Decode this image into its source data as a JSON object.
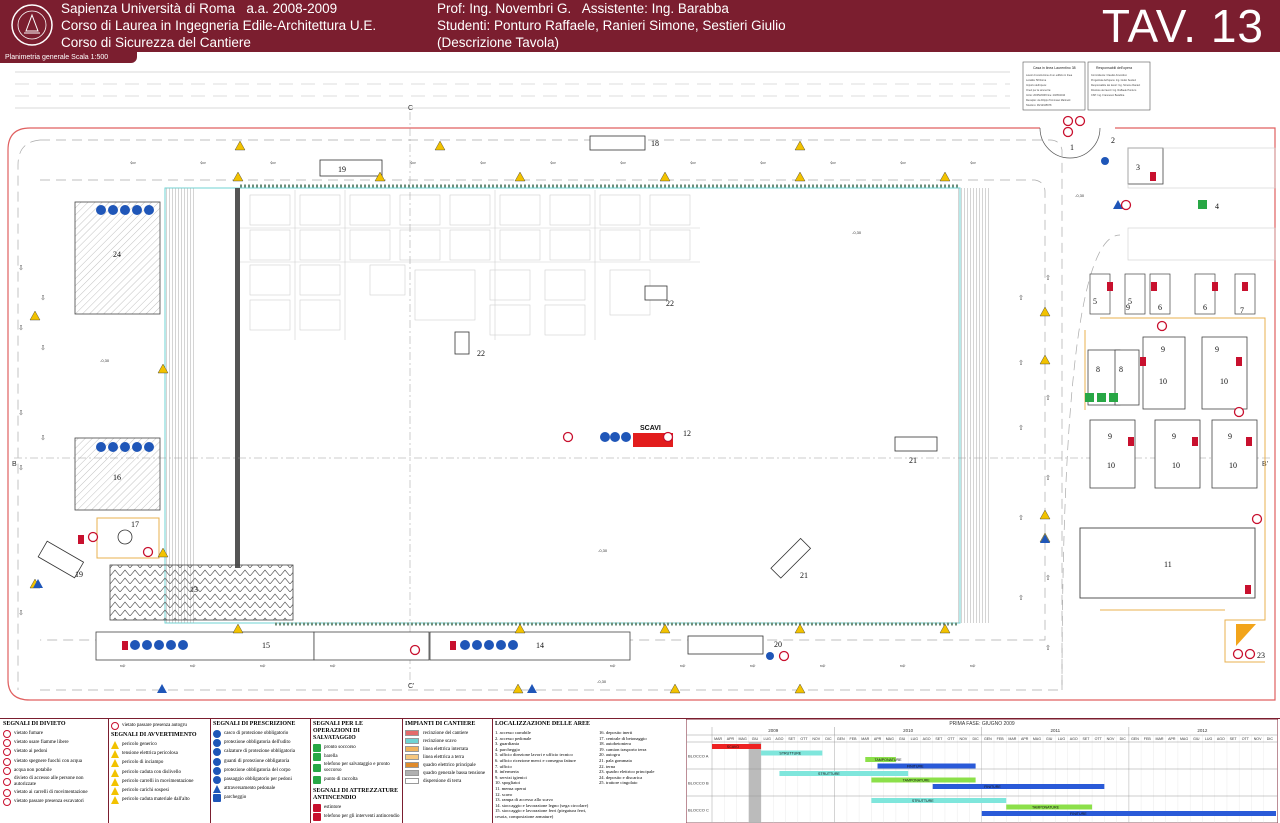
{
  "header": {
    "university": "Sapienza Università di Roma",
    "year": "a.a. 2008-2009",
    "course1": "Corso di Laurea in Ingegneria Edile-Architettura U.E.",
    "course2": "Corso di Sicurezza del Cantiere",
    "professors": "Prof: Ing. Novembri G.   Assistente: Ing. Barabba",
    "students": "Studenti: Ponturo Raffaele, Ranieri Simone, Sestieri Giulio",
    "description": "(Descrizione Tavola)",
    "tav": "TAV. 13"
  },
  "plan": {
    "subtitle": "Planimetria generale Scala 1:500",
    "section_labels": [
      "C",
      "C'",
      "B",
      "B'"
    ],
    "area_labels": {
      "a1": "1",
      "a2": "2",
      "a3": "3",
      "a4": "4",
      "a5a": "5",
      "a5b": "5",
      "a6a": "6",
      "a6b": "6",
      "a7": "7",
      "a8a": "8",
      "a8b": "8",
      "a9a": "9",
      "a9b": "9",
      "a9c": "9",
      "a9d": "9",
      "a9e": "9",
      "a9f": "9",
      "a10a": "10",
      "a10b": "10",
      "a10c": "10",
      "a10d": "10",
      "a10e": "10",
      "a11": "11",
      "a12": "12",
      "a13": "13",
      "a14": "14",
      "a15": "15",
      "a16": "16",
      "a17": "17",
      "a18": "18",
      "a19a": "19",
      "a19b": "19",
      "a20": "20",
      "a21a": "21",
      "a21b": "21",
      "a22a": "22",
      "a22b": "22",
      "a23": "23",
      "a24": "24"
    },
    "scavi_label": "SCAVI",
    "elevations": [
      "-0,30",
      "-0,30",
      "-0,30",
      "-0,30",
      "-0,30"
    ],
    "cartello": {
      "title": "Casa in linea Laurentino 38",
      "lines": [
        "Lavori di costruzione di un edificio in linea",
        "Località: 58 Roma",
        "Importo dell'opera:",
        "Oneri per la sicurezza:",
        "Inizio: 20/05/2008    Fine: 20/05/2010",
        "Recapito: via Filippo Tommaso Marinetti",
        "Telefono: 06/12345678"
      ],
      "resp_title": "Responsabili dell'opera",
      "resp_lines": [
        "Committente: Claudio Amorotico",
        "Progettista dell'opera: Ing. Giulio Sestieri",
        "Responsabile dei lavori: Ing. Simone Ranieri",
        "Direttore dei lavori: Ing. Raffaele Ponturo",
        "CSP: Ing. Francesco Barabba"
      ]
    }
  },
  "legend": {
    "divieto": {
      "title": "SEGNALI DI DIVIETO",
      "items": [
        "vietato fumare",
        "vietato usare fiamme libere",
        "vietato ai pedoni",
        "vietato spegnere fuochi con acqua",
        "acqua non potabile",
        "divieto di accesso alle persone non autorizzate",
        "vietato ai carrelli di movimentazione",
        "vietato passare presenza escavatori"
      ]
    },
    "avvertimento": {
      "first": "vietato passare presenza autogru",
      "title": "SEGNALI DI AVVERTIMENTO",
      "items": [
        "pericolo generico",
        "tensione elettrica pericolosa",
        "pericolo di inciampo",
        "pericolo caduta con dislivello",
        "pericolo carrelli in movimentazione",
        "pericolo carichi sospesi",
        "pericolo caduta materiale dall'alto"
      ]
    },
    "prescrizione": {
      "title": "SEGNALI DI PRESCRIZIONE",
      "items": [
        "casco di protezione obbligatorio",
        "protezione obbligatoria dell'udito",
        "calzature di protezione obbligatoria",
        "guanti di protezione obbligatoria",
        "protezione obbligatoria del corpo",
        "passaggio obbligatorio per pedoni",
        "attraversamento pedonale",
        "parcheggio"
      ]
    },
    "salvataggio": {
      "title": "SEGNALI PER LE OPERAZIONI DI SALVATAGGIO",
      "items": [
        "pronto soccorso",
        "barella",
        "telefono per salvataggio e pronto soccorso",
        "punto di raccolta"
      ],
      "fire_title": "SEGNALI DI ATTREZZATURE ANTINCENDIO",
      "fire_items": [
        "estintore",
        "telefono per gli interventi antincendio"
      ]
    },
    "impianti": {
      "title": "IMPIANTI DI CANTIERE",
      "items": [
        {
          "label": "recinzione del cantiere",
          "color": "#e46a6a"
        },
        {
          "label": "recinzione scavo",
          "color": "#6fd3d3"
        },
        {
          "label": "linea elettrica interrata",
          "color": "#f1b35d"
        },
        {
          "label": "linea elettrica a terra",
          "color": "#f6c77f"
        },
        {
          "label": "quadro elettrico principale",
          "color": "#e08b2c"
        },
        {
          "label": "quadro generale bassa tensione",
          "color": "#b0b0b0"
        },
        {
          "label": "dispersione di terra",
          "color": "#ffffff"
        }
      ]
    },
    "localizzazione": {
      "title": "LOCALIZZAZIONE DELLE AREE",
      "col1": [
        "1. accesso carrabile",
        "2. accesso pedonale",
        "3. guardiania",
        "4. parcheggio",
        "5. ufficio direzione lavori e ufficio tecnico",
        "6. ufficio ricezione merci e consegna fatture",
        "7. ufficio",
        "8. infermeria",
        "9. servizi igienici",
        "10. spogliatoi",
        "11. mensa operai",
        "12. scavo",
        "13. rampa di accesso allo scavo",
        "14. stoccaggio e lavorazione legno (sega circolare)",
        "15. stoccaggio e lavorazione ferri (piegatura ferri, cesoia, composizione armature)"
      ],
      "col2": [
        "16. deposito inerti",
        "17. centrale di betonaggio",
        "18. autobetoniera",
        "19. camion trasporto terra",
        "20. autogru",
        "21. pala gommata",
        "22. terna",
        "23. quadro elettrico principale",
        "24. deposito e discarica",
        "25. trattore cingolato"
      ]
    }
  },
  "gantt": {
    "title": "PRIMA FASE: GIUGNO 2009",
    "years": [
      "2009",
      "2010",
      "2011",
      "2012"
    ],
    "months": [
      "MAR",
      "APR",
      "MAG",
      "GIU",
      "LUG",
      "AGO",
      "SET",
      "OTT",
      "NOV",
      "DIC",
      "GEN",
      "FEB",
      "MAR",
      "APR",
      "MAG",
      "GIU",
      "LUG",
      "AGO",
      "SET",
      "OTT",
      "NOV",
      "DIC",
      "GEN",
      "FEB",
      "MAR",
      "APR",
      "MAG",
      "GIU",
      "LUG",
      "AGO",
      "SET",
      "OTT",
      "NOV",
      "DIC",
      "GEN",
      "FEB",
      "MAR",
      "APR",
      "MAG",
      "GIU",
      "LUG",
      "AGO",
      "SET",
      "OTT",
      "NOV",
      "DIC"
    ],
    "rows": [
      {
        "name": "BLOCCO A",
        "tasks": [
          {
            "label": "SCAVO",
            "start": 0,
            "end": 4,
            "color": "#ee2222"
          },
          {
            "label": "STRUTTURE",
            "start": 4,
            "end": 9,
            "color": "#7fe6dc"
          },
          {
            "label": "TAMPONATURE",
            "start": 12.5,
            "end": 15,
            "color": "#8ce04a"
          },
          {
            "label": "FINITURE",
            "start": 13.5,
            "end": 21.5,
            "color": "#2a5ad8"
          }
        ]
      },
      {
        "name": "BLOCCO B",
        "tasks": [
          {
            "label": "STRUTTURE",
            "start": 5.5,
            "end": 16,
            "color": "#7fe6dc"
          },
          {
            "label": "TAMPONATURE",
            "start": 13,
            "end": 21.5,
            "color": "#8ce04a"
          },
          {
            "label": "FINITURE",
            "start": 18,
            "end": 32,
            "color": "#2a5ad8"
          }
        ]
      },
      {
        "name": "BLOCCO C",
        "tasks": [
          {
            "label": "STRUTTURE",
            "start": 13,
            "end": 24,
            "color": "#7fe6dc"
          },
          {
            "label": "TAMPONATURE",
            "start": 24,
            "end": 31,
            "color": "#8ce04a"
          },
          {
            "label": "FINITURE",
            "start": 22,
            "end": 46,
            "color": "#2a5ad8"
          }
        ]
      }
    ]
  }
}
